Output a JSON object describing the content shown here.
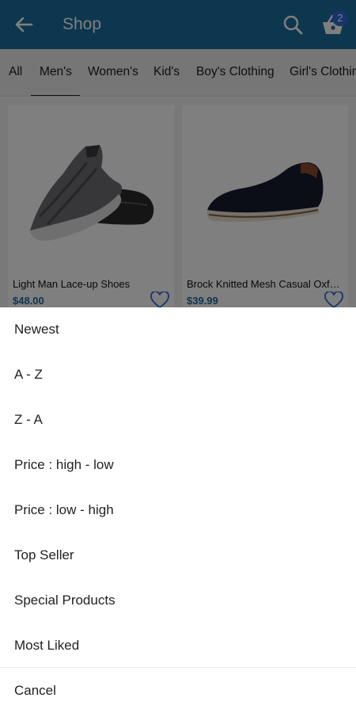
{
  "appbar": {
    "title": "Shop",
    "cart_count": "2",
    "icons": [
      "back-arrow-icon",
      "search-icon",
      "cart-basket-icon"
    ],
    "color": "#1b6f9f"
  },
  "tabs": [
    "All",
    "Men's",
    "Women's",
    "Kid's",
    "Boy's Clothing",
    "Girl's Clothing"
  ],
  "selected_tab": "Men's",
  "products": [
    {
      "name": "Light Man Lace-up Shoes",
      "price": "$48.00"
    },
    {
      "name": "Brock Knitted Mesh Casual Oxfo…",
      "price": "$39.99"
    }
  ],
  "sort_sheet": {
    "options": [
      "Newest",
      "A - Z",
      "Z - A",
      "Price : high - low",
      "Price : low - high",
      "Top Seller",
      "Special Products",
      "Most Liked"
    ],
    "cancel": "Cancel"
  },
  "colors": {
    "price": "#1b6f9f",
    "badge": "#2f6bd6",
    "heart": "#2f6bd6"
  }
}
